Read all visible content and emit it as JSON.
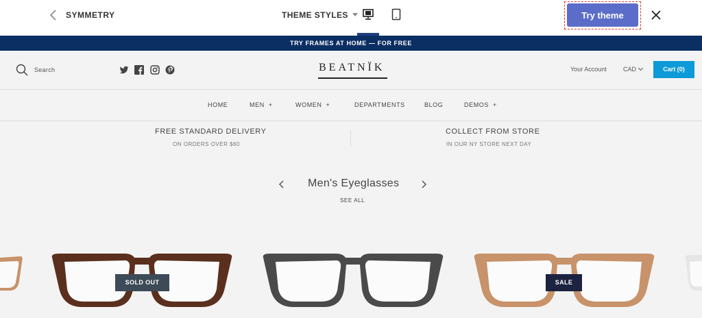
{
  "preview_bar": {
    "store_name": "SYMMETRY",
    "theme_styles_label": "THEME STYLES",
    "try_theme_label": "Try theme"
  },
  "announcement": "TRY FRAMES AT HOME — FOR FREE",
  "header": {
    "search_label": "Search",
    "logo_text": "BEATNÏK",
    "account_label": "Your Account",
    "currency": "CAD",
    "cart_label": "Cart (0)"
  },
  "nav": {
    "items": [
      {
        "label": "HOME",
        "plus": ""
      },
      {
        "label": "MEN",
        "plus": "+"
      },
      {
        "label": "WOMEN",
        "plus": "+"
      },
      {
        "label": "DEPARTMENTS",
        "plus": ""
      },
      {
        "label": "BLOG",
        "plus": ""
      },
      {
        "label": "DEMOS",
        "plus": "+"
      }
    ]
  },
  "benefits": [
    {
      "title": "FREE STANDARD DELIVERY",
      "subtitle": "ON ORDERS OVER $60"
    },
    {
      "title": "COLLECT FROM STORE",
      "subtitle": "IN OUR NY STORE NEXT DAY"
    }
  ],
  "collection": {
    "title": "Men's Eyeglasses",
    "see_all": "SEE ALL"
  },
  "products": [
    {
      "badge": "SOLD OUT",
      "frame_color": "#5a2f1e"
    },
    {
      "badge": "",
      "frame_color": "#4a4a4a"
    },
    {
      "badge": "SALE",
      "frame_color": "#c8926a"
    }
  ],
  "colors": {
    "announcement_bg": "#0b2e63",
    "try_theme_bg": "#5b6dc9",
    "cart_bg": "#0d9ad8"
  }
}
